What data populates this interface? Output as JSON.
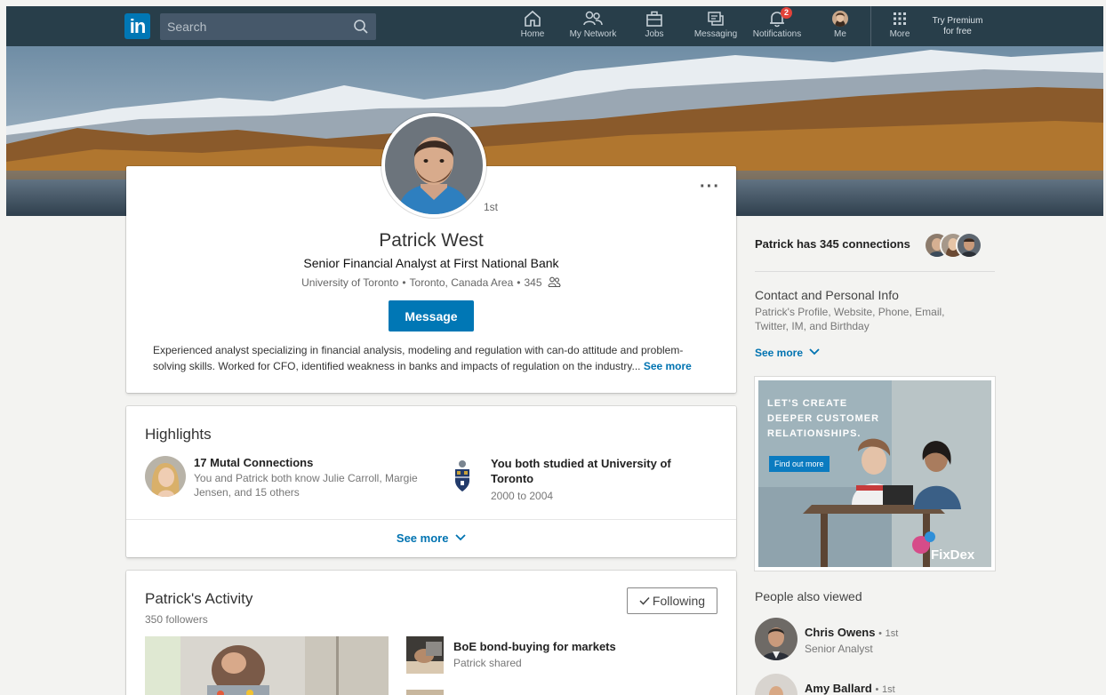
{
  "nav": {
    "logo_text": "in",
    "search_placeholder": "Search",
    "items": [
      {
        "label": "Home",
        "icon": "home-icon"
      },
      {
        "label": "My Network",
        "icon": "network-icon"
      },
      {
        "label": "Jobs",
        "icon": "briefcase-icon"
      },
      {
        "label": "Messaging",
        "icon": "messaging-icon"
      },
      {
        "label": "Notifications",
        "icon": "bell-icon",
        "badge": "2"
      },
      {
        "label": "Me",
        "icon": "avatar"
      },
      {
        "label": "More",
        "icon": "grid-icon"
      }
    ],
    "premium_line1": "Try Premium",
    "premium_line2": "for free",
    "colors": {
      "bar": "#283e4a",
      "accent": "#0077b5"
    }
  },
  "profile": {
    "degree": "1st",
    "name": "Patrick West",
    "headline": "Senior Financial Analyst at First National Bank",
    "school": "University of Toronto",
    "location": "Toronto, Canada Area",
    "connections": "345",
    "message_label": "Message",
    "summary": "Experienced analyst specializing in financial analysis, modeling and regulation with can-do attitude and problem-solving skills. Worked for CFO, identified weakness in banks and impacts of regulation on the industry...",
    "see_more": "See more"
  },
  "highlights": {
    "title": "Highlights",
    "mutual_title": "17 Mutal Connections",
    "mutual_desc": "You and Patrick both know Julie Carroll, Margie Jensen, and 15 others",
    "school_title": "You both studied at University of Toronto",
    "school_years": "2000 to 2004",
    "see_more": "See more"
  },
  "activity": {
    "title": "Patrick's Activity",
    "followers": "350 followers",
    "following_label": "Following",
    "items": [
      {
        "title": "BoE bond-buying for markets",
        "sub": "Patrick shared"
      }
    ]
  },
  "rail": {
    "connections_title": "Patrick has 345 connections",
    "contact_title": "Contact and Personal Info",
    "contact_desc": "Patrick's Profile, Website, Phone, Email, Twitter, IM, and Birthday",
    "see_more": "See more",
    "ad": {
      "headline_1": "LET'S CREATE",
      "headline_2": "DEEPER CUSTOMER",
      "headline_3": "RELATIONSHIPS.",
      "cta": "Find out more",
      "brand": "FixDex"
    },
    "people_title": "People also viewed",
    "people": [
      {
        "name": "Chris Owens",
        "degree": "1st",
        "role": "Senior Analyst"
      },
      {
        "name": "Amy Ballard",
        "degree": "1st",
        "role": ""
      }
    ]
  }
}
